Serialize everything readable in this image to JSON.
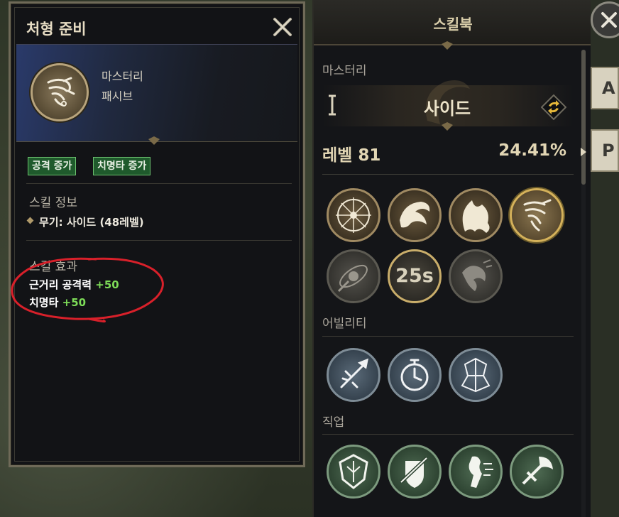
{
  "tooltip": {
    "title": "처형 준비",
    "skill_type": "마스터리",
    "skill_sub": "패시브",
    "tags": [
      "공격 증가",
      "치명타 증가"
    ],
    "info_title": "스킬 정보",
    "info_line": "무기: 사이드 (48레벨)",
    "effects_title": "스킬 효과",
    "effects": [
      {
        "label": "근거리 공격력 ",
        "value": "+50"
      },
      {
        "label": "치명타 ",
        "value": "+50"
      }
    ]
  },
  "skillbook": {
    "title": "스킬북",
    "mastery_label": "마스터리",
    "mastery_name": "사이드",
    "level_label": "레벨 81",
    "progress_label": "24.41%",
    "progress": 0.2441,
    "cooldown_label": "25s",
    "abilities_label": "어빌리티",
    "class_label": "직업",
    "mastery_icons": [
      "compass-sigil-icon",
      "dragon-claw-icon",
      "ghost-flame-icon",
      "chained-claw-icon",
      "meteor-icon",
      "cooldown-skill-icon",
      "chain-beast-icon"
    ],
    "ability_icons": [
      "sword-burst-icon",
      "stopwatch-icon",
      "shattered-figure-icon"
    ],
    "class_icons": [
      "crest-shield-icon",
      "shield-sword-icon",
      "dash-figure-icon",
      "axe-sword-icon"
    ]
  },
  "side_tabs": [
    "A",
    "P"
  ],
  "colors": {
    "accent_gold": "#d4b15a",
    "effect_green": "#7ddc58",
    "tag_green": "#1f5a2c",
    "annotation_red": "#d8202a"
  }
}
